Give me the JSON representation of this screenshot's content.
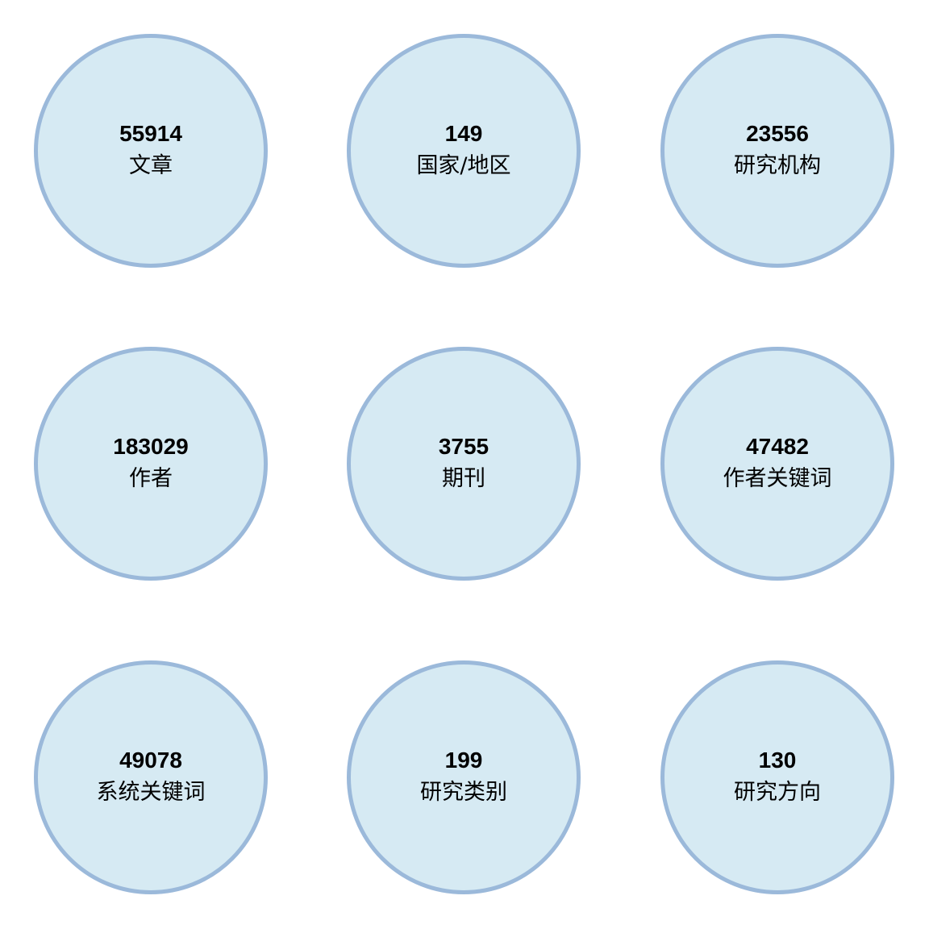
{
  "colors": {
    "bubble_fill": "#d6eaf3",
    "bubble_border": "#9bb9da",
    "text": "#000000"
  },
  "stats": [
    {
      "value": "55914",
      "label": "文章"
    },
    {
      "value": "149",
      "label": "国家/地区"
    },
    {
      "value": "23556",
      "label": "研究机构"
    },
    {
      "value": "183029",
      "label": "作者"
    },
    {
      "value": "3755",
      "label": "期刊"
    },
    {
      "value": "47482",
      "label": "作者关键词"
    },
    {
      "value": "49078",
      "label": "系统关键词"
    },
    {
      "value": "199",
      "label": "研究类别"
    },
    {
      "value": "130",
      "label": "研究方向"
    }
  ]
}
